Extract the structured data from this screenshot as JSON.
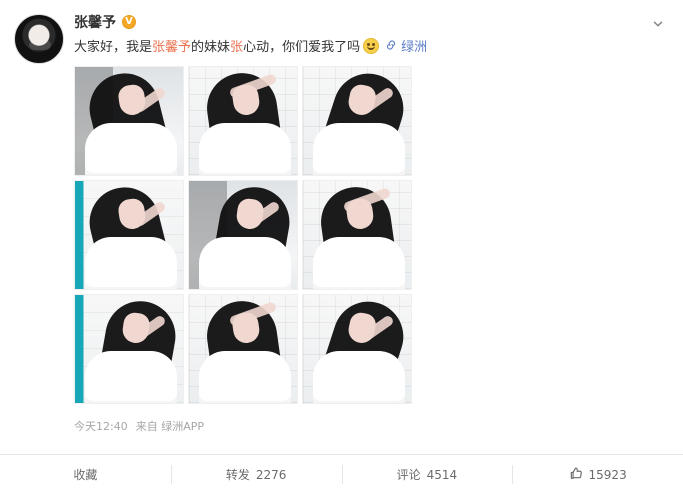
{
  "post": {
    "author": {
      "name": "张馨予",
      "verified_badge": "V"
    },
    "text": {
      "prefix": "大家好，我是",
      "highlight1": "张馨予",
      "middle": "的妹妹",
      "highlight2": "张",
      "suffix": "心动，你们爱我了吗",
      "emoji_icon": "smirk-emoji-icon",
      "topic_link": "绿洲"
    },
    "meta": {
      "time": "今天12:40",
      "source": "来自 绿洲APP"
    },
    "actions": {
      "favorite": "收藏",
      "repost_label": "转发",
      "repost_count": "2276",
      "comment_label": "评论",
      "comment_count": "4514",
      "like_count": "15923"
    },
    "icons": {
      "menu": "chevron-down-icon",
      "link": "link-icon",
      "like": "thumbs-up-icon"
    },
    "colors": {
      "highlight": "#eb7350",
      "link": "#5b7ec7",
      "meta": "#a6a6a6"
    }
  }
}
